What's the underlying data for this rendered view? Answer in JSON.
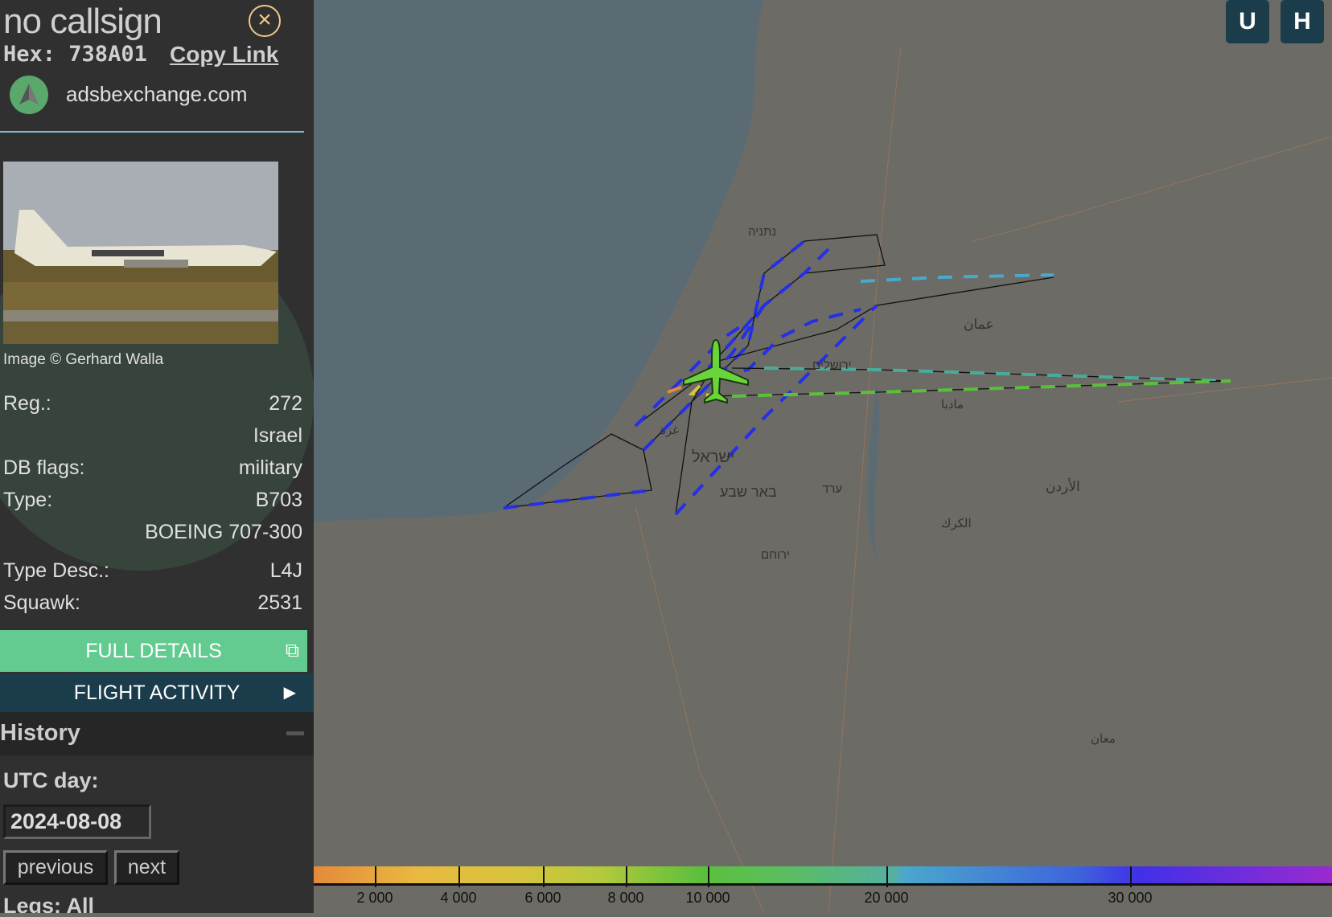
{
  "aircraft": {
    "callsign": "no callsign",
    "hex_label": "Hex:",
    "hex": "738A01",
    "copy_link": "Copy Link",
    "site": "adsbexchange.com",
    "image_credit": "Image © Gerhard Walla",
    "fields": [
      {
        "label": "Reg.:",
        "value": "272"
      },
      {
        "label": "",
        "value": "Israel"
      },
      {
        "label": "DB flags:",
        "value": "military"
      },
      {
        "label": "Type:",
        "value": "B703"
      },
      {
        "label": "",
        "value": "BOEING 707-300"
      },
      {
        "label": "Type Desc.:",
        "value": "L4J"
      },
      {
        "label": "Squawk:",
        "value": "2531"
      }
    ]
  },
  "buttons": {
    "full_details": "FULL DETAILS",
    "flight_activity": "FLIGHT ACTIVITY",
    "u": "U",
    "h": "H"
  },
  "history": {
    "title": "History",
    "utc_label": "UTC day:",
    "date": "2024-08-08",
    "previous": "previous",
    "next": "next",
    "legs": "Legs: All"
  },
  "legend": {
    "ticks": [
      "2 000",
      "4 000",
      "6 000",
      "8 000",
      "10 000",
      "20 000",
      "30 000"
    ]
  },
  "map_labels": [
    "נתניה",
    "ירושלים",
    "ישראל",
    "באר שבע",
    "غزة",
    "عمان",
    "الأردن",
    "مادبا",
    "الكرك",
    "ערד",
    "ירוחם",
    "معان"
  ],
  "colors": {
    "accent_green": "#63cb8f",
    "dark_teal": "#1b3c4b",
    "track_blue": "#2430e8",
    "aircraft": "#6ad43c"
  }
}
